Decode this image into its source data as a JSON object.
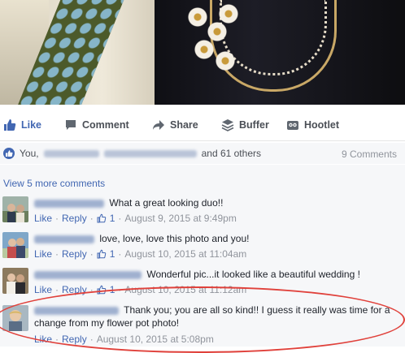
{
  "actions": {
    "like": "Like",
    "comment": "Comment",
    "share": "Share",
    "buffer": "Buffer",
    "hootlet": "Hootlet"
  },
  "likes_summary": {
    "prefix": "You,",
    "suffix": "and 61 others",
    "comments_count": "9 Comments"
  },
  "comments_section": {
    "view_more": "View 5 more comments",
    "items": [
      {
        "text": "What a great looking duo!!",
        "like": "Like",
        "reply": "Reply",
        "likes": "1",
        "time": "August 9, 2015 at 9:49pm"
      },
      {
        "text": "love, love, love this photo and you!",
        "like": "Like",
        "reply": "Reply",
        "likes": "1",
        "time": "August 10, 2015 at 11:04am"
      },
      {
        "text": "Wonderful pic...it looked like a beautiful wedding !",
        "like": "Like",
        "reply": "Reply",
        "likes": "1",
        "time": "August 10, 2015 at 11:12am"
      },
      {
        "text": "Thank you; you are all so kind!! I guess it really was time for a change from my flower pot photo!",
        "like": "Like",
        "reply": "Reply",
        "time": "August 10, 2015 at 5:08pm"
      }
    ]
  },
  "colors": {
    "link": "#4267b2",
    "meta": "#90949c",
    "annotation": "#e0413b"
  }
}
